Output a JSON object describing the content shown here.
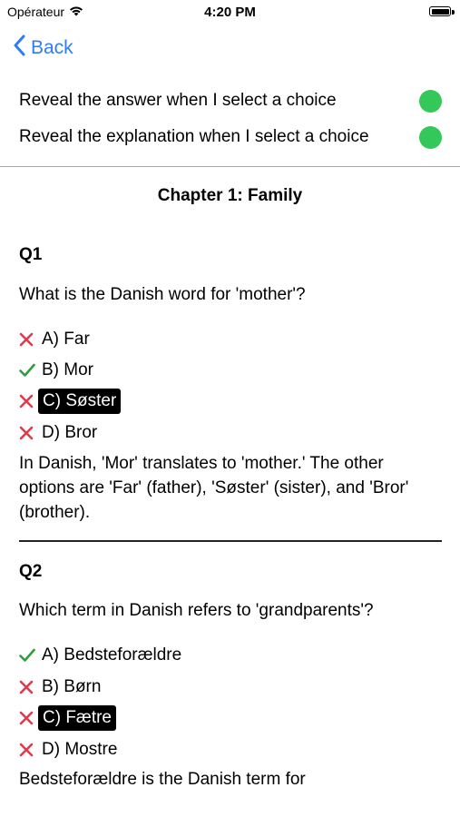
{
  "status_bar": {
    "carrier": "Opérateur",
    "time": "4:20 PM"
  },
  "nav": {
    "back_label": "Back"
  },
  "settings": {
    "reveal_answer_label": "Reveal the answer when I select a choice",
    "reveal_explanation_label": "Reveal the explanation when I select a choice",
    "toggle_color": "#34C759"
  },
  "chapter": {
    "title": "Chapter 1: Family"
  },
  "questions": [
    {
      "label": "Q1",
      "text": "What is the Danish word for 'mother'?",
      "choices": [
        {
          "text": "A) Far",
          "correct": false,
          "selected": false
        },
        {
          "text": "B) Mor",
          "correct": true,
          "selected": false
        },
        {
          "text": "C) Søster",
          "correct": false,
          "selected": true
        },
        {
          "text": "D) Bror",
          "correct": false,
          "selected": false
        }
      ],
      "explanation": "In Danish, 'Mor' translates to 'mother.' The other options are 'Far' (father), 'Søster' (sister), and 'Bror' (brother)."
    },
    {
      "label": "Q2",
      "text": "Which term in Danish refers to 'grandparents'?",
      "choices": [
        {
          "text": "A) Bedsteforældre",
          "correct": true,
          "selected": false
        },
        {
          "text": "B) Børn",
          "correct": false,
          "selected": false
        },
        {
          "text": "C) Fætre",
          "correct": false,
          "selected": true
        },
        {
          "text": "D) Mostre",
          "correct": false,
          "selected": false
        }
      ],
      "explanation": "Bedsteforældre is the Danish term for"
    }
  ],
  "colors": {
    "accent": "#2F7CF6",
    "correct": "#2E9E3E",
    "wrong": "#E03A4E"
  }
}
